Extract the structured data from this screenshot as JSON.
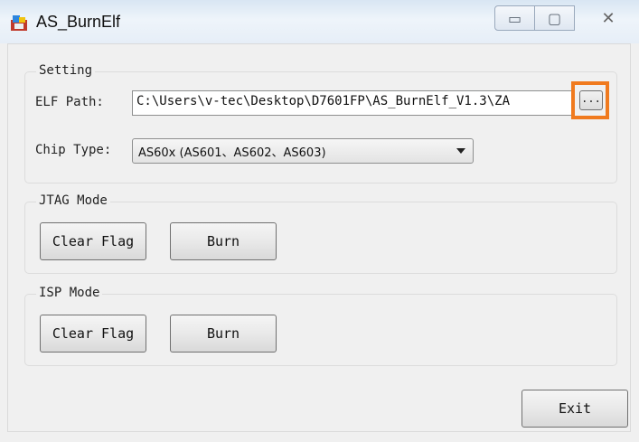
{
  "window": {
    "title": "AS_BurnElf",
    "icon": "app-icon",
    "controls": {
      "minimize": "▭",
      "maximize": "▢",
      "close": "✕"
    }
  },
  "setting": {
    "group_title": "Setting",
    "elf_path_label": "ELF Path:",
    "elf_path_value": "C:\\Users\\v-tec\\Desktop\\D7601FP\\AS_BurnElf_V1.3\\ZA",
    "browse_label": "...",
    "chip_type_label": "Chip Type:",
    "chip_type_value": "AS60x (AS601、AS602、AS603)"
  },
  "jtag": {
    "group_title": "JTAG Mode",
    "clear_flag_label": "Clear Flag",
    "burn_label": "Burn"
  },
  "isp": {
    "group_title": "ISP Mode",
    "clear_flag_label": "Clear Flag",
    "burn_label": "Burn"
  },
  "footer": {
    "exit_label": "Exit"
  },
  "colors": {
    "highlight": "#f07a1e"
  }
}
